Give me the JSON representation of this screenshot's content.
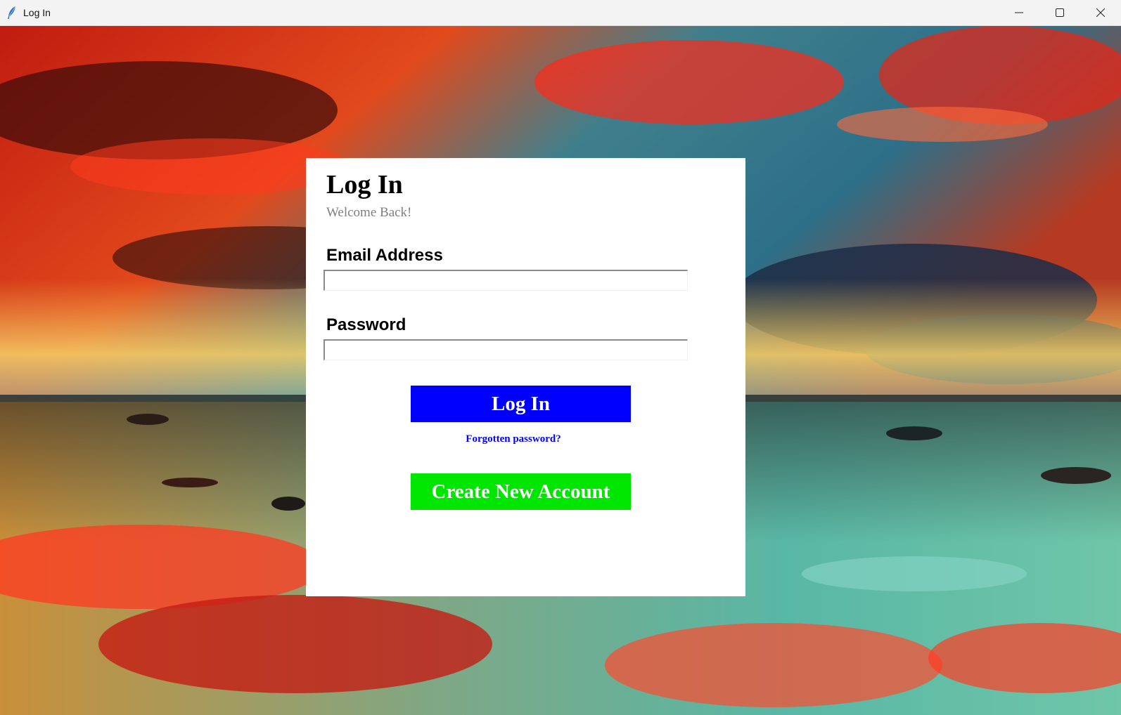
{
  "window": {
    "title": "Log In",
    "icon": "feather-icon",
    "controls": [
      "minimize-icon",
      "maximize-icon",
      "close-icon"
    ]
  },
  "background": {
    "description_icon": "sunset-ocean-wallpaper"
  },
  "login": {
    "heading": "Log In",
    "subheading": "Welcome Back!",
    "email_label": "Email Address",
    "email_value": "",
    "password_label": "Password",
    "password_value": "",
    "login_button": "Log In",
    "forgot_link": "Forgotten password?",
    "create_button": "Create New Account"
  },
  "colors": {
    "login_button": "#0000ff",
    "create_button": "#00e600",
    "link": "#0000ff",
    "subheading": "#7f7f7f"
  }
}
